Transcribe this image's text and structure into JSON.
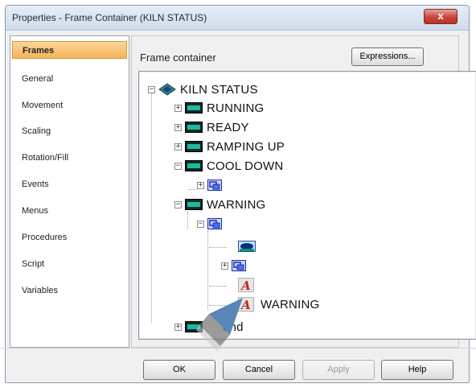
{
  "window": {
    "title": "Properties - Frame Container (KILN STATUS)",
    "close_label": "x"
  },
  "nav": {
    "items": [
      {
        "label": "Frames",
        "selected": true
      },
      {
        "label": "General"
      },
      {
        "label": "Movement"
      },
      {
        "label": "Scaling"
      },
      {
        "label": "Rotation/Fill"
      },
      {
        "label": "Events"
      },
      {
        "label": "Menus"
      },
      {
        "label": "Procedures"
      },
      {
        "label": "Script"
      },
      {
        "label": "Variables"
      }
    ]
  },
  "panel": {
    "label": "Frame container",
    "expressions_button": "Expressions..."
  },
  "tree": {
    "root": "KILN STATUS",
    "running": "RUNNING",
    "ready": "READY",
    "ramping_up": "RAMPING UP",
    "cool_down": "COOL DOWN",
    "warning": "WARNING",
    "warning_text": "WARNING",
    "last_partial": "end",
    "text_icon_glyph": "A",
    "expand_glyph": "+",
    "collapse_glyph": "−"
  },
  "footer": {
    "ok": "OK",
    "cancel": "Cancel",
    "apply": "Apply",
    "help": "Help"
  },
  "colors": {
    "selected_tab": "#f4b45a",
    "frame_icon": "#1a9a8a",
    "container_icon": "#2f4fd8",
    "text_icon": "#c0281e",
    "cursor": "#5a86b8"
  }
}
